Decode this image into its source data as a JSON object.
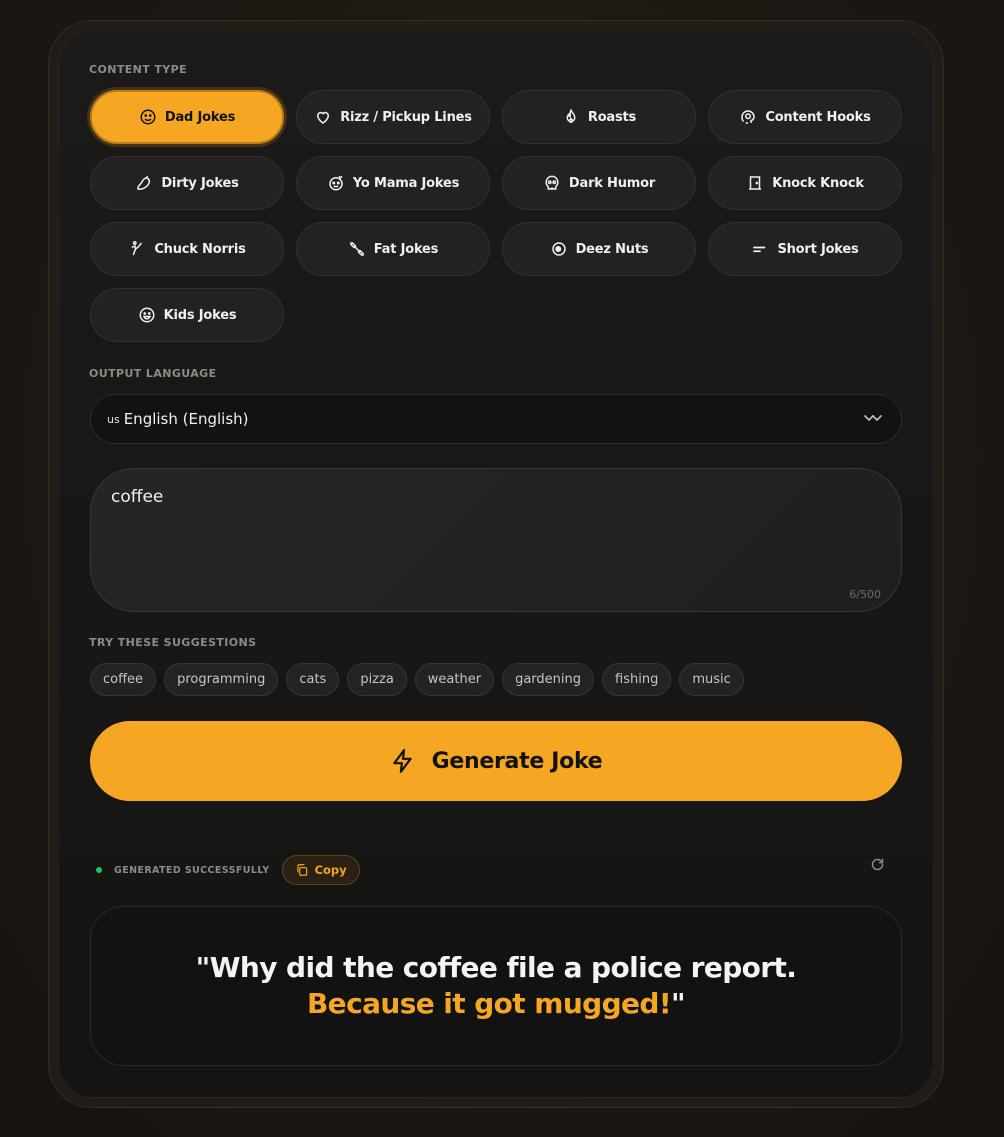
{
  "content_type": {
    "label": "CONTENT TYPE",
    "options": [
      {
        "label": "Dad Jokes",
        "icon": "smile-icon",
        "active": true
      },
      {
        "label": "Rizz / Pickup Lines",
        "icon": "heart-icon",
        "active": false
      },
      {
        "label": "Roasts",
        "icon": "flame-icon",
        "active": false
      },
      {
        "label": "Content Hooks",
        "icon": "hook-icon",
        "active": false
      },
      {
        "label": "Dirty Jokes",
        "icon": "eggplant-icon",
        "active": false
      },
      {
        "label": "Yo Mama Jokes",
        "icon": "face-icon",
        "active": false
      },
      {
        "label": "Dark Humor",
        "icon": "skull-icon",
        "active": false
      },
      {
        "label": "Knock Knock",
        "icon": "door-icon",
        "active": false
      },
      {
        "label": "Chuck Norris",
        "icon": "kick-icon",
        "active": false
      },
      {
        "label": "Fat Jokes",
        "icon": "dumbbell-icon",
        "active": false
      },
      {
        "label": "Deez Nuts",
        "icon": "nut-icon",
        "active": false
      },
      {
        "label": "Short Jokes",
        "icon": "short-lines-icon",
        "active": false
      },
      {
        "label": "Kids Jokes",
        "icon": "kid-face-icon",
        "active": false
      }
    ]
  },
  "output_language": {
    "label": "OUTPUT LANGUAGE",
    "flag": "US",
    "selected": "English (English)"
  },
  "topic": {
    "value": "coffee",
    "char_count": "6/500"
  },
  "suggestions": {
    "label": "TRY THESE SUGGESTIONS",
    "items": [
      "coffee",
      "programming",
      "cats",
      "pizza",
      "weather",
      "gardening",
      "fishing",
      "music"
    ]
  },
  "generate_button": {
    "label": "Generate Joke"
  },
  "result": {
    "status": "GENERATED SUCCESSFULLY",
    "copy_label": "Copy",
    "line1": "\"Why did the coffee file a police report.",
    "line2": "Because it got mugged!",
    "closing_quote": "\""
  },
  "colors": {
    "accent": "#f5a623",
    "success": "#22c55e",
    "card_bg": "#171615"
  }
}
